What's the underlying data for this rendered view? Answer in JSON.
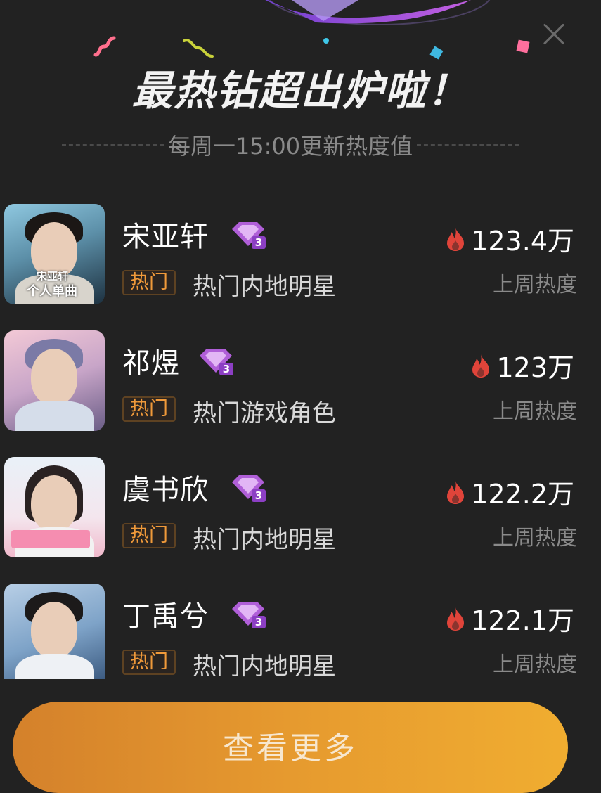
{
  "header": {
    "title": "最热钻超出炉啦！",
    "subtitle": "每周一15:00更新热度值"
  },
  "close_icon": "close-icon",
  "list": [
    {
      "name": "宋亚轩",
      "badge_level": "3",
      "tag": "热门",
      "category": "热门内地明星",
      "heat": "123.4万",
      "heat_label": "上周热度",
      "avatar_text": [
        "宋亚轩",
        "个人单曲"
      ]
    },
    {
      "name": "祁煜",
      "badge_level": "3",
      "tag": "热门",
      "category": "热门游戏角色",
      "heat": "123万",
      "heat_label": "上周热度"
    },
    {
      "name": "虞书欣",
      "badge_level": "3",
      "tag": "热门",
      "category": "热门内地明星",
      "heat": "122.2万",
      "heat_label": "上周热度"
    },
    {
      "name": "丁禹兮",
      "badge_level": "3",
      "tag": "热门",
      "category": "热门内地明星",
      "heat": "122.1万",
      "heat_label": "上周热度"
    }
  ],
  "footer": {
    "more_label": "查看更多"
  },
  "colors": {
    "background": "#222222",
    "tag_text": "#f09a3a",
    "flame": "#e0443a",
    "badge": "#b05fd8",
    "button_start": "#d4812b",
    "button_end": "#f0ad30"
  }
}
